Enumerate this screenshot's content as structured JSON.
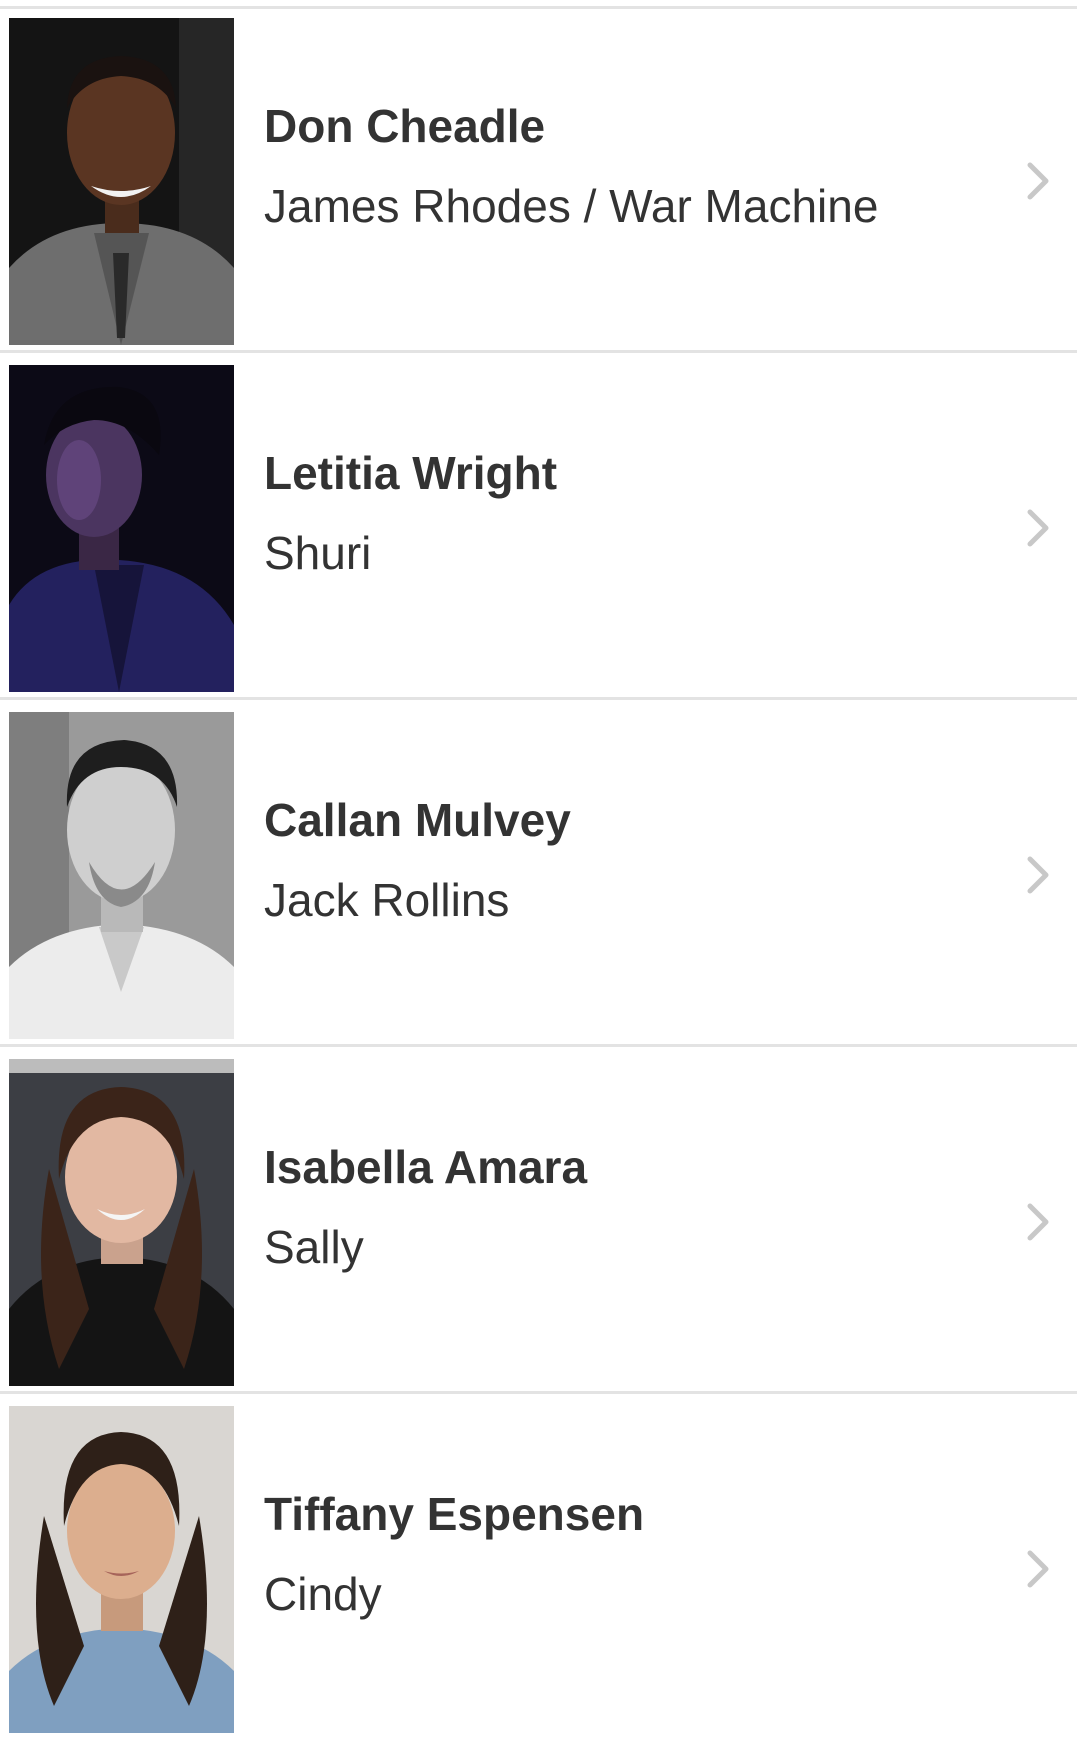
{
  "cast": [
    {
      "actor": "Don Cheadle",
      "character": "James Rhodes / War Machine",
      "photo_icon": "actor-portrait"
    },
    {
      "actor": "Letitia Wright",
      "character": "Shuri",
      "photo_icon": "actor-portrait"
    },
    {
      "actor": "Callan Mulvey",
      "character": "Jack Rollins",
      "photo_icon": "actor-portrait"
    },
    {
      "actor": "Isabella Amara",
      "character": "Sally",
      "photo_icon": "actor-portrait"
    },
    {
      "actor": "Tiffany Espensen",
      "character": "Cindy",
      "photo_icon": "actor-portrait"
    }
  ],
  "colors": {
    "text": "#333333",
    "divider": "#e3e3e3",
    "chevron": "#c8c8c8",
    "background": "#ffffff"
  }
}
